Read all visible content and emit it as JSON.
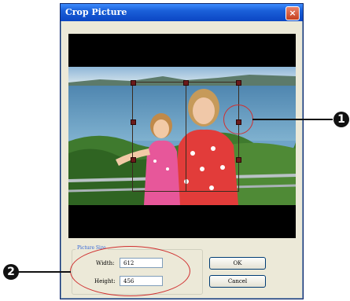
{
  "window": {
    "title": "Crop Picture",
    "close_label": "×"
  },
  "picture_size": {
    "group_label": "Picture Size",
    "width_label": "Width:",
    "width_value": "612",
    "height_label": "Height:",
    "height_value": "456"
  },
  "buttons": {
    "ok_label": "OK",
    "cancel_label": "Cancel"
  },
  "callouts": {
    "one": "1",
    "two": "2"
  },
  "colors": {
    "titlebar": "#0b46c4",
    "dialog_background": "#ece9d8",
    "crop_handles": "#6b1a1a",
    "callout_circle": "#d03030"
  }
}
